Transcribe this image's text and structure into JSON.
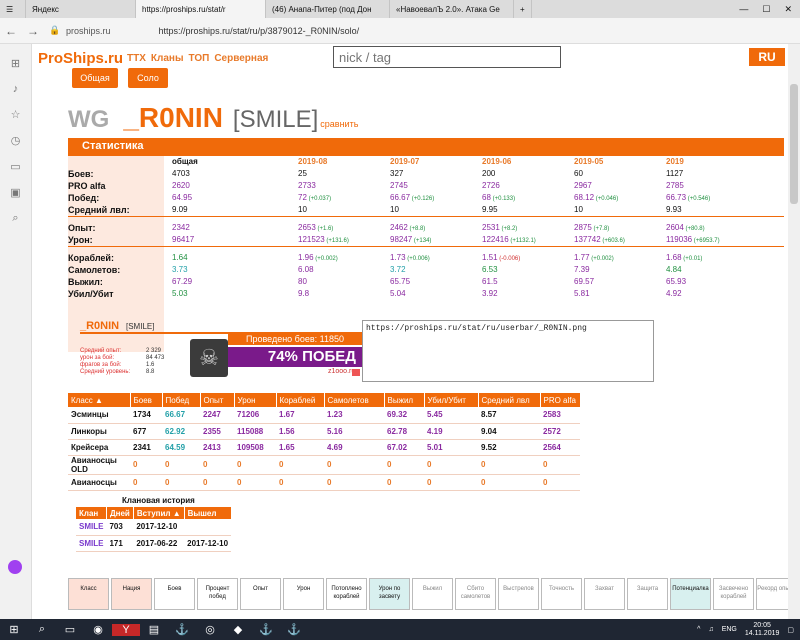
{
  "browser": {
    "tabs": [
      {
        "label": "Яндекс",
        "active": false
      },
      {
        "label": "https://proships.ru/stat/r",
        "active": true
      },
      {
        "label": "(46) Анапа-Питер (под Дон",
        "active": false
      },
      {
        "label": "«НавоевалЪ 2.0». Атака Ge",
        "active": false
      }
    ],
    "site_short": "proships.ru",
    "url": "https://proships.ru/stat/ru/p/3879012-_R0NIN/solo/"
  },
  "site": {
    "logo": "ProShips.ru",
    "nav": [
      "ТТХ",
      "Кланы",
      "ТОП",
      "Серверная"
    ],
    "search_placeholder": "nick / tag",
    "lang": "RU",
    "btn_general": "Общая",
    "btn_solo": "Соло"
  },
  "player": {
    "server": "WG",
    "nick": "_R0NIN",
    "clan": "[SMILE]",
    "compare": "сравнить"
  },
  "stats": {
    "title": "Статистика",
    "headers": [
      "общая",
      "2019-08",
      "2019-07",
      "2019-06",
      "2019-05",
      "2019"
    ],
    "rows": [
      {
        "label": "Боев:",
        "vals": [
          "4703",
          "25",
          "327",
          "200",
          "60",
          "1127"
        ]
      },
      {
        "label": "PRO alfa",
        "vals": [
          "2620",
          "2733",
          "2745",
          "2726",
          "2967",
          "2785"
        ]
      },
      {
        "label": "Побед:",
        "vals": [
          "64.95",
          "72",
          "66.67",
          "68",
          "68.12",
          "66.73"
        ],
        "delta": [
          "",
          "(+0.037)",
          "(+0.126)",
          "(+0.133)",
          "(+0.046)",
          "(+0.546)"
        ]
      },
      {
        "label": "Средний лвл:",
        "vals": [
          "9.09",
          "10",
          "10",
          "9.95",
          "10",
          "9.93"
        ]
      },
      {
        "label": "Опыт:",
        "vals": [
          "2342",
          "2653",
          "2462",
          "2531",
          "2875",
          "2604"
        ],
        "delta": [
          "",
          "(+1.6)",
          "(+8.8)",
          "(+8.2)",
          "(+7.8)",
          "(+80.8)"
        ]
      },
      {
        "label": "Урон:",
        "vals": [
          "96417",
          "121523",
          "98247",
          "122416",
          "137742",
          "119036"
        ],
        "delta": [
          "",
          "(+131.6)",
          "(+134)",
          "(+1132.1)",
          "(+603.6)",
          "(+6953.7)"
        ]
      },
      {
        "label": "Кораблей:",
        "vals": [
          "1.64",
          "1.96",
          "1.73",
          "1.51",
          "1.77",
          "1.68"
        ],
        "delta": [
          "",
          "(+0.002)",
          "(+0.006)",
          "(-0.006)",
          "(+0.002)",
          "(+0.01)"
        ]
      },
      {
        "label": "Самолетов:",
        "vals": [
          "3.73",
          "6.08",
          "3.72",
          "6.53",
          "7.39",
          "4.84"
        ]
      },
      {
        "label": "Выжил:",
        "vals": [
          "67.29",
          "80",
          "65.75",
          "61.5",
          "69.57",
          "65.93"
        ]
      },
      {
        "label": "Убил/Убит",
        "vals": [
          "5.03",
          "9.8",
          "5.04",
          "3.92",
          "5.81",
          "4.92"
        ]
      }
    ]
  },
  "userbar": {
    "nick": "_R0NIN",
    "clan": "[SMILE]",
    "battles": "Проведено боев: 11850",
    "labels": [
      "Средний опыт:",
      "урон за бой:",
      "фрагов за бой:",
      "Средний уровень:"
    ],
    "values": [
      "2 329",
      "84 473",
      "1.6",
      "8.8"
    ],
    "winrate": "74% ПОБЕД",
    "site": "z1ooo.ru",
    "link": "https://proships.ru/stat/ru/userbar/_R0NIN.png"
  },
  "classes": {
    "headers": [
      "Класс",
      "Боев",
      "Побед",
      "Опыт",
      "Урон",
      "Кораблей",
      "Самолетов",
      "Выжил",
      "Убил/Убит",
      "Средний лвл",
      "PRO alfa"
    ],
    "rows": [
      [
        "Эсминцы",
        "1734",
        "66.67",
        "2247",
        "71206",
        "1.67",
        "1.23",
        "69.32",
        "5.45",
        "8.57",
        "2583"
      ],
      [
        "Линкоры",
        "677",
        "62.92",
        "2355",
        "115088",
        "1.56",
        "5.16",
        "62.78",
        "4.19",
        "9.04",
        "2572"
      ],
      [
        "Крейсера",
        "2341",
        "64.59",
        "2413",
        "109508",
        "1.65",
        "4.69",
        "67.02",
        "5.01",
        "9.52",
        "2564"
      ],
      [
        "Авианосцы OLD",
        "0",
        "0",
        "0",
        "0",
        "0",
        "0",
        "0",
        "0",
        "0",
        "0"
      ],
      [
        "Авианосцы",
        "0",
        "0",
        "0",
        "0",
        "0",
        "0",
        "0",
        "0",
        "0",
        "0"
      ]
    ]
  },
  "clan_history": {
    "title": "Клановая история",
    "headers": [
      "Клан",
      "Дней",
      "Вступил",
      "Вышел"
    ],
    "rows": [
      [
        "SMILE",
        "703",
        "2017-12-10",
        ""
      ],
      [
        "SMILE",
        "171",
        "2017-06-22",
        "2017-12-10"
      ]
    ]
  },
  "filters": [
    "Класс",
    "Нация",
    "Боев",
    "Процент побед",
    "Опыт",
    "Урон",
    "Потоплено кораблей",
    "Урон по засвету",
    "Выжил",
    "Сбито самолетов",
    "Выстрелов",
    "Точность",
    "Захват",
    "Защита",
    "Потенциалка",
    "Засвечено кораблей",
    "Рекорд опыта"
  ],
  "taskbar": {
    "lang": "ENG",
    "time": "20:05",
    "date": "14.11.2019"
  }
}
